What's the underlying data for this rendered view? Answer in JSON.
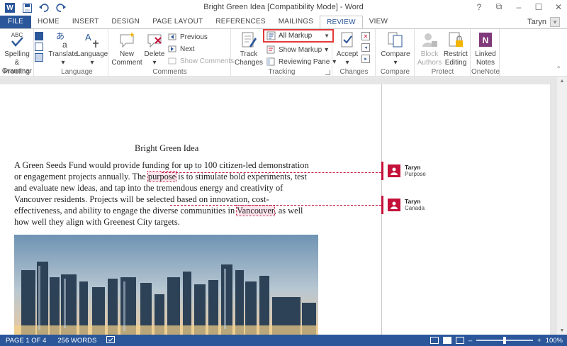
{
  "window": {
    "title": "Bright Green Idea [Compatibility Mode] - Word",
    "controls": [
      "?",
      "⧉",
      "–",
      "☐",
      "✕"
    ]
  },
  "qat": {
    "icons": [
      "word-icon",
      "save-icon",
      "undo-icon",
      "redo-icon"
    ]
  },
  "tabs": [
    "FILE",
    "HOME",
    "INSERT",
    "DESIGN",
    "PAGE LAYOUT",
    "REFERENCES",
    "MAILINGS",
    "REVIEW",
    "VIEW"
  ],
  "active_tab": "REVIEW",
  "user": {
    "name": "Taryn"
  },
  "ribbon": {
    "proofing": {
      "label": "Proofing",
      "spelling": "Spelling &",
      "grammar": "Grammar",
      "abc_icon": "ABC"
    },
    "language": {
      "label": "Language",
      "translate": "Translate",
      "language": "Language"
    },
    "comments": {
      "label": "Comments",
      "new": "New",
      "comment": "Comment",
      "delete": "Delete",
      "previous": "Previous",
      "next": "Next",
      "show_comments": "Show Comments"
    },
    "tracking": {
      "label": "Tracking",
      "track": "Track",
      "changes": "Changes",
      "markup_value": "All Markup",
      "show_markup": "Show Markup",
      "reviewing_pane": "Reviewing Pane"
    },
    "changes": {
      "label": "Changes",
      "accept": "Accept"
    },
    "compare": {
      "label": "Compare",
      "compare": "Compare"
    },
    "protect": {
      "label": "Protect",
      "block": "Block",
      "authors": "Authors",
      "restrict": "Restrict",
      "editing": "Editing"
    },
    "onenote": {
      "label": "OneNote",
      "linked": "Linked",
      "notes": "Notes"
    }
  },
  "document": {
    "title": "Bright Green Idea",
    "p1": "A Green Seeds Fund would provide funding for up to 100 citizen-led demonstration or engagement projects annually. The ",
    "hl1": "purpose",
    "p2": " is to stimulate bold experiments, test and evaluate new ideas, and tap into the tremendous energy and creativity of Vancouver residents. Projects will be selected based on innovation, cost-effectiveness, and ability to engage the diverse communities in ",
    "hl2": "Vancouver",
    "p3": ", as well how well they align with Greenest City targets."
  },
  "comments": [
    {
      "author": "Taryn",
      "text": "Purpose"
    },
    {
      "author": "Taryn",
      "text": "Canada"
    }
  ],
  "status": {
    "page": "PAGE 1 OF 4",
    "words": "256 WORDS",
    "zoom": "100%",
    "zoom_level": 0.5
  },
  "colors": {
    "word_blue": "#2b579a",
    "markup_highlight": "#e23a3a",
    "comment_red": "#c4123a"
  }
}
